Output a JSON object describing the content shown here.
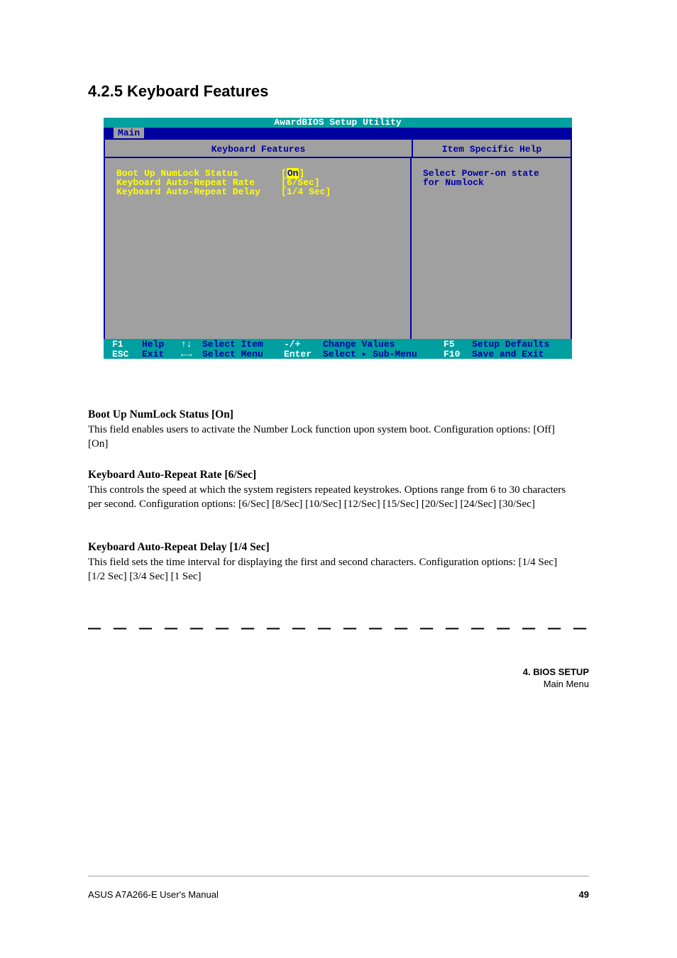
{
  "section_title": "4.2.5 Keyboard Features",
  "bios": {
    "title": "AwardBIOS Setup Utility",
    "menu_tab": "Main",
    "left_header": "Keyboard Features",
    "right_header": "Item Specific Help",
    "settings": [
      {
        "label": "Boot Up NumLock Status",
        "value": "On",
        "selected": true
      },
      {
        "label": "Keyboard Auto-Repeat Rate",
        "value": "6/Sec",
        "selected": false
      },
      {
        "label": "Keyboard Auto-Repeat Delay",
        "value": "1/4 Sec",
        "selected": false
      }
    ],
    "help_text_line1": "Select Power-on state",
    "help_text_line2": "for Numlock",
    "footer": {
      "row1": {
        "k1": "F1",
        "t1": "Help",
        "k2": "↑↓",
        "t2": "Select Item",
        "k3": "-/+",
        "t3": "Change Values",
        "k4": "F5",
        "t4": "Setup Defaults"
      },
      "row2": {
        "k1": "ESC",
        "t1": "Exit",
        "k2": "←→",
        "t2": "Select Menu",
        "k3": "Enter",
        "t3": "Select ▸ Sub-Menu",
        "k4": "F10",
        "t4": "Save and Exit"
      }
    }
  },
  "paragraphs": {
    "h1": "Boot Up NumLock Status [On]",
    "p1": "This field enables users to activate the Number Lock function upon system boot. Configuration options: [Off] [On]",
    "h2": "Keyboard Auto-Repeat Rate [6/Sec]",
    "p2": "This controls the speed at which the system registers repeated keystrokes. Options range from 6 to 30 characters per second. Configuration options: [6/Sec] [8/Sec] [10/Sec] [12/Sec] [15/Sec] [20/Sec] [24/Sec] [30/Sec]",
    "h3": "Keyboard Auto-Repeat Delay [1/4 Sec]",
    "p3": "This field sets the time interval for displaying the first and second characters. Configuration options: [1/4 Sec] [1/2 Sec] [3/4 Sec] [1 Sec]"
  },
  "dashed": "— — — — — — — — — — — — — — — — — — — — — — — —",
  "page_footer": {
    "left": "ASUS A7A266-E User's Manual",
    "right": "49",
    "chapter_num": "4. BIOS SETUP",
    "chapter_sub": "Main Menu"
  }
}
